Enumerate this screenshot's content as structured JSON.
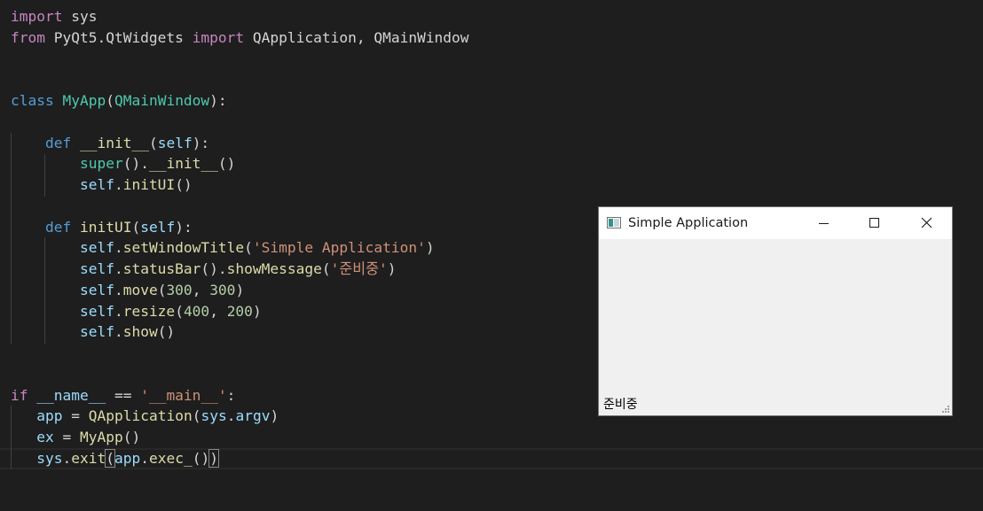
{
  "editor": {
    "lines": [
      {
        "row": 0,
        "tokens": [
          {
            "c": "kw",
            "t": "import"
          },
          {
            "c": "txt",
            "t": " sys"
          }
        ]
      },
      {
        "row": 1,
        "tokens": [
          {
            "c": "kw",
            "t": "from"
          },
          {
            "c": "txt",
            "t": " PyQt5.QtWidgets "
          },
          {
            "c": "kw",
            "t": "import"
          },
          {
            "c": "txt",
            "t": " QApplication, QMainWindow"
          }
        ]
      },
      {
        "row": 4,
        "tokens": [
          {
            "c": "kwb",
            "t": "class"
          },
          {
            "c": "txt",
            "t": " "
          },
          {
            "c": "cls",
            "t": "MyApp"
          },
          {
            "c": "txt",
            "t": "("
          },
          {
            "c": "cls",
            "t": "QMainWindow"
          },
          {
            "c": "txt",
            "t": "):"
          }
        ]
      },
      {
        "row": 6,
        "tokens": [
          {
            "c": "txt",
            "t": "    "
          },
          {
            "c": "kwb",
            "t": "def"
          },
          {
            "c": "txt",
            "t": " "
          },
          {
            "c": "fn",
            "t": "__init__"
          },
          {
            "c": "txt",
            "t": "("
          },
          {
            "c": "var",
            "t": "self"
          },
          {
            "c": "txt",
            "t": "):"
          }
        ]
      },
      {
        "row": 7,
        "tokens": [
          {
            "c": "txt",
            "t": "        "
          },
          {
            "c": "cls",
            "t": "super"
          },
          {
            "c": "txt",
            "t": "()."
          },
          {
            "c": "fn",
            "t": "__init__"
          },
          {
            "c": "txt",
            "t": "()"
          }
        ]
      },
      {
        "row": 8,
        "tokens": [
          {
            "c": "txt",
            "t": "        "
          },
          {
            "c": "var",
            "t": "self"
          },
          {
            "c": "txt",
            "t": "."
          },
          {
            "c": "fn",
            "t": "initUI"
          },
          {
            "c": "txt",
            "t": "()"
          }
        ]
      },
      {
        "row": 10,
        "tokens": [
          {
            "c": "txt",
            "t": "    "
          },
          {
            "c": "kwb",
            "t": "def"
          },
          {
            "c": "txt",
            "t": " "
          },
          {
            "c": "fn",
            "t": "initUI"
          },
          {
            "c": "txt",
            "t": "("
          },
          {
            "c": "var",
            "t": "self"
          },
          {
            "c": "txt",
            "t": "):"
          }
        ]
      },
      {
        "row": 11,
        "tokens": [
          {
            "c": "txt",
            "t": "        "
          },
          {
            "c": "var",
            "t": "self"
          },
          {
            "c": "txt",
            "t": "."
          },
          {
            "c": "fn",
            "t": "setWindowTitle"
          },
          {
            "c": "txt",
            "t": "("
          },
          {
            "c": "str",
            "t": "'Simple Application'"
          },
          {
            "c": "txt",
            "t": ")"
          }
        ]
      },
      {
        "row": 12,
        "tokens": [
          {
            "c": "txt",
            "t": "        "
          },
          {
            "c": "var",
            "t": "self"
          },
          {
            "c": "txt",
            "t": "."
          },
          {
            "c": "fn",
            "t": "statusBar"
          },
          {
            "c": "txt",
            "t": "()."
          },
          {
            "c": "fn",
            "t": "showMessage"
          },
          {
            "c": "txt",
            "t": "("
          },
          {
            "c": "str",
            "t": "'준비중'"
          },
          {
            "c": "txt",
            "t": ")"
          }
        ]
      },
      {
        "row": 13,
        "tokens": [
          {
            "c": "txt",
            "t": "        "
          },
          {
            "c": "var",
            "t": "self"
          },
          {
            "c": "txt",
            "t": "."
          },
          {
            "c": "fn",
            "t": "move"
          },
          {
            "c": "txt",
            "t": "("
          },
          {
            "c": "num",
            "t": "300"
          },
          {
            "c": "txt",
            "t": ", "
          },
          {
            "c": "num",
            "t": "300"
          },
          {
            "c": "txt",
            "t": ")"
          }
        ]
      },
      {
        "row": 14,
        "tokens": [
          {
            "c": "txt",
            "t": "        "
          },
          {
            "c": "var",
            "t": "self"
          },
          {
            "c": "txt",
            "t": "."
          },
          {
            "c": "fn",
            "t": "resize"
          },
          {
            "c": "txt",
            "t": "("
          },
          {
            "c": "num",
            "t": "400"
          },
          {
            "c": "txt",
            "t": ", "
          },
          {
            "c": "num",
            "t": "200"
          },
          {
            "c": "txt",
            "t": ")"
          }
        ]
      },
      {
        "row": 15,
        "tokens": [
          {
            "c": "txt",
            "t": "        "
          },
          {
            "c": "var",
            "t": "self"
          },
          {
            "c": "txt",
            "t": "."
          },
          {
            "c": "fn",
            "t": "show"
          },
          {
            "c": "txt",
            "t": "()"
          }
        ]
      },
      {
        "row": 18,
        "tokens": [
          {
            "c": "kw",
            "t": "if"
          },
          {
            "c": "txt",
            "t": " "
          },
          {
            "c": "var",
            "t": "__name__"
          },
          {
            "c": "txt",
            "t": " == "
          },
          {
            "c": "str",
            "t": "'__main__'"
          },
          {
            "c": "txt",
            "t": ":"
          }
        ]
      },
      {
        "row": 19,
        "tokens": [
          {
            "c": "txt",
            "t": "   "
          },
          {
            "c": "var",
            "t": "app"
          },
          {
            "c": "txt",
            "t": " = "
          },
          {
            "c": "fn",
            "t": "QApplication"
          },
          {
            "c": "txt",
            "t": "("
          },
          {
            "c": "var",
            "t": "sys"
          },
          {
            "c": "txt",
            "t": "."
          },
          {
            "c": "var",
            "t": "argv"
          },
          {
            "c": "txt",
            "t": ")"
          }
        ]
      },
      {
        "row": 20,
        "tokens": [
          {
            "c": "txt",
            "t": "   "
          },
          {
            "c": "var",
            "t": "ex"
          },
          {
            "c": "txt",
            "t": " = "
          },
          {
            "c": "fn",
            "t": "MyApp"
          },
          {
            "c": "txt",
            "t": "()"
          }
        ]
      },
      {
        "row": 21,
        "tokens": [
          {
            "c": "txt",
            "t": "   "
          },
          {
            "c": "var",
            "t": "sys"
          },
          {
            "c": "txt",
            "t": "."
          },
          {
            "c": "fn",
            "t": "exit"
          },
          {
            "c": "txt",
            "t": "(",
            "m": 1
          },
          {
            "c": "var",
            "t": "app"
          },
          {
            "c": "txt",
            "t": "."
          },
          {
            "c": "fn",
            "t": "exec_"
          },
          {
            "c": "txt",
            "t": "()"
          },
          {
            "c": "txt",
            "t": ")",
            "m": 1
          }
        ]
      }
    ]
  },
  "window": {
    "title": "Simple Application",
    "status_message": "준비중",
    "icon": "app-window-icon",
    "controls": [
      "minimize-icon",
      "maximize-icon",
      "close-icon"
    ]
  },
  "colors": {
    "editor_background": "#1e1e1e",
    "keyword_control": "#c586c0",
    "keyword": "#569cd6",
    "class_name": "#4ec9b0",
    "function_name": "#dcdcaa",
    "string": "#ce9178",
    "number": "#b5cea8",
    "variable": "#9cdcfe",
    "window_background": "#f0f0f0"
  }
}
